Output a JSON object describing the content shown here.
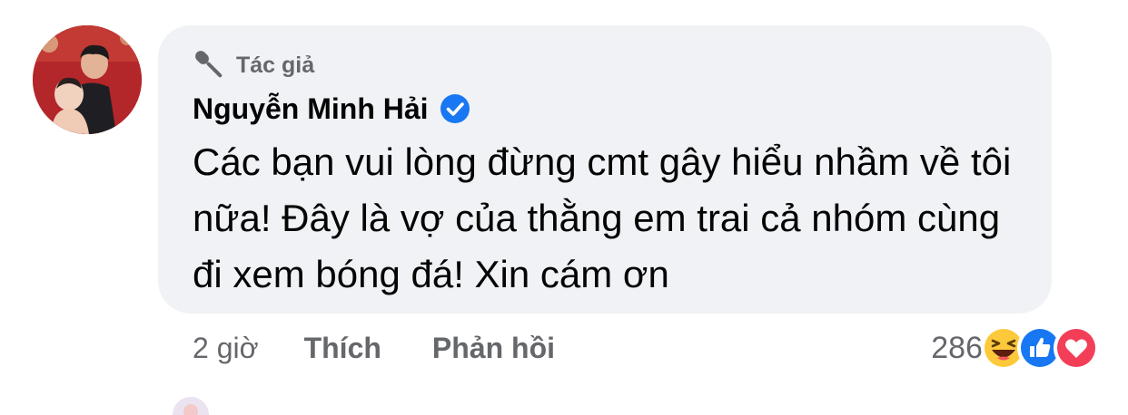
{
  "comment": {
    "author_badge": "Tác giả",
    "author_name": "Nguyễn Minh Hải",
    "verified": true,
    "text": "Các bạn vui lòng đừng cmt gây hiểu nhầm về tôi nữa! Đây là vợ của thằng em trai cả nhóm cùng đi xem bóng đá! Xin cám ơn",
    "time": "2 giờ",
    "like_label": "Thích",
    "reply_label": "Phản hồi",
    "reaction_count": "286",
    "reactions": [
      "haha-icon",
      "like-icon",
      "love-icon"
    ]
  },
  "colors": {
    "bubble_bg": "#f0f2f5",
    "secondary_text": "#65676b",
    "primary_text": "#050505",
    "verified_blue": "#1877f2",
    "love_red": "#f33e58"
  }
}
